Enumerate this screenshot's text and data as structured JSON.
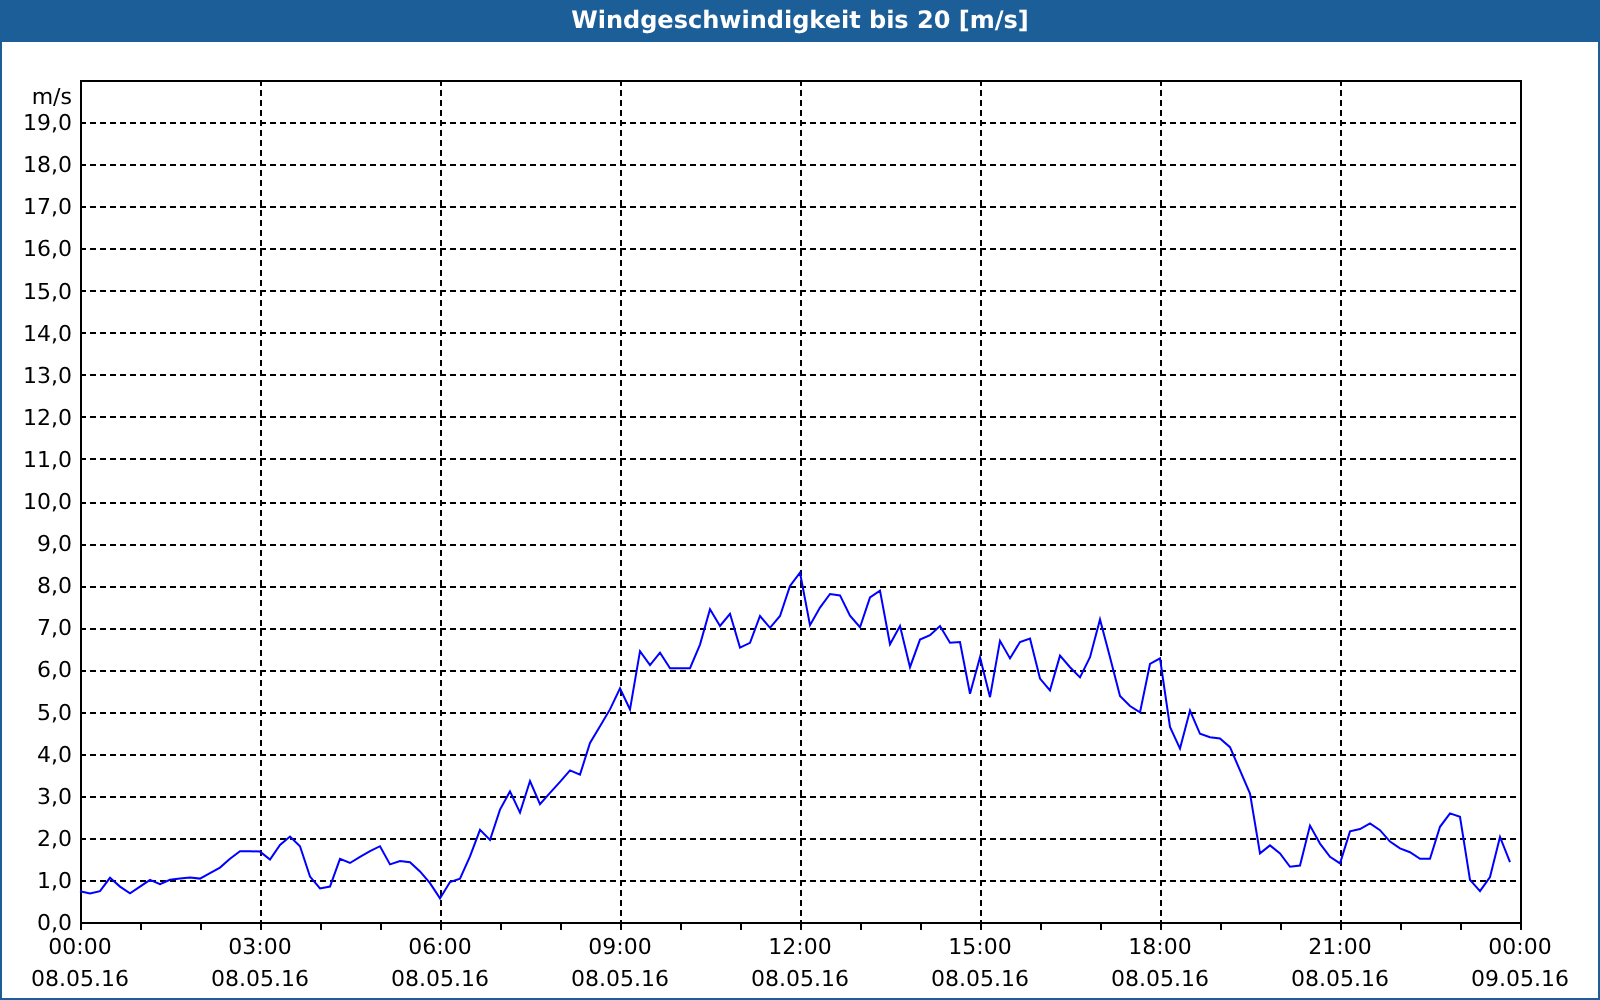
{
  "window": {
    "title": "Windgeschwindigkeit bis 20 [m/s]"
  },
  "chart": {
    "chart_data": {
      "type": "line",
      "ylabel": "m/s",
      "grid": true,
      "ylim": [
        0,
        20
      ],
      "yticks": [
        {
          "value": 0,
          "label": "0,0"
        },
        {
          "value": 1,
          "label": "1,0"
        },
        {
          "value": 2,
          "label": "2,0"
        },
        {
          "value": 3,
          "label": "3,0"
        },
        {
          "value": 4,
          "label": "4,0"
        },
        {
          "value": 5,
          "label": "5,0"
        },
        {
          "value": 6,
          "label": "6,0"
        },
        {
          "value": 7,
          "label": "7,0"
        },
        {
          "value": 8,
          "label": "8,0"
        },
        {
          "value": 9,
          "label": "9,0"
        },
        {
          "value": 10,
          "label": "10,0"
        },
        {
          "value": 11,
          "label": "11,0"
        },
        {
          "value": 12,
          "label": "12,0"
        },
        {
          "value": 13,
          "label": "13,0"
        },
        {
          "value": 14,
          "label": "14,0"
        },
        {
          "value": 15,
          "label": "15,0"
        },
        {
          "value": 16,
          "label": "16,0"
        },
        {
          "value": 17,
          "label": "17,0"
        },
        {
          "value": 18,
          "label": "18,0"
        },
        {
          "value": 19,
          "label": "19,0"
        }
      ],
      "categories": [
        "00:00\n08.05.16",
        null,
        null,
        null,
        null,
        null,
        null,
        null,
        null,
        null,
        null,
        null,
        null,
        null,
        null,
        null,
        null,
        null,
        "03:00\n08.05.16",
        null,
        null,
        null,
        null,
        null,
        null,
        null,
        null,
        null,
        null,
        null,
        null,
        null,
        null,
        null,
        null,
        null,
        "06:00\n08.05.16",
        null,
        null,
        null,
        null,
        null,
        null,
        null,
        null,
        null,
        null,
        null,
        null,
        null,
        null,
        null,
        null,
        null,
        "09:00\n08.05.16",
        null,
        null,
        null,
        null,
        null,
        null,
        null,
        null,
        null,
        null,
        null,
        null,
        null,
        null,
        null,
        null,
        null,
        "12:00\n08.05.16",
        null,
        null,
        null,
        null,
        null,
        null,
        null,
        null,
        null,
        null,
        null,
        null,
        null,
        null,
        null,
        null,
        null,
        "15:00\n08.05.16",
        null,
        null,
        null,
        null,
        null,
        null,
        null,
        null,
        null,
        null,
        null,
        null,
        null,
        null,
        null,
        null,
        null,
        "18:00\n08.05.16",
        null,
        null,
        null,
        null,
        null,
        null,
        null,
        null,
        null,
        null,
        null,
        null,
        null,
        null,
        null,
        null,
        null,
        "21:00\n08.05.16",
        null,
        null,
        null,
        null,
        null,
        null,
        null,
        null,
        null,
        null,
        null,
        null,
        null,
        null,
        null,
        null,
        null,
        "00:00\n09.05.16"
      ],
      "series": [
        {
          "color": "#0000ff",
          "values": [
            0.73,
            0.68,
            0.73,
            1.05,
            0.84,
            0.68,
            0.84,
            1.0,
            0.9,
            1.0,
            1.03,
            1.06,
            1.03,
            1.16,
            1.29,
            1.5,
            1.68,
            1.68,
            1.67,
            1.48,
            1.83,
            2.03,
            1.8,
            1.08,
            0.8,
            0.84,
            1.5,
            1.4,
            1.55,
            1.68,
            1.8,
            1.37,
            1.45,
            1.42,
            1.2,
            0.92,
            0.56,
            0.95,
            1.03,
            1.56,
            2.19,
            1.95,
            2.67,
            3.1,
            2.6,
            3.35,
            2.8,
            3.07,
            3.33,
            3.6,
            3.5,
            4.25,
            4.65,
            5.05,
            5.55,
            5.05,
            6.43,
            6.1,
            6.4,
            6.03,
            6.03,
            6.03,
            6.59,
            7.43,
            7.03,
            7.32,
            6.52,
            6.63,
            7.27,
            6.99,
            7.27,
            7.98,
            8.3,
            7.05,
            7.47,
            7.79,
            7.76,
            7.28,
            7.0,
            7.71,
            7.87,
            6.6,
            7.03,
            6.05,
            6.71,
            6.81,
            7.03,
            6.63,
            6.65,
            5.42,
            6.29,
            5.34,
            6.68,
            6.26,
            6.65,
            6.73,
            5.78,
            5.5,
            6.33,
            6.05,
            5.81,
            6.29,
            7.19,
            6.29,
            5.37,
            5.13,
            4.98,
            6.13,
            6.26,
            4.63,
            4.12,
            5.02,
            4.47,
            4.39,
            4.36,
            4.15,
            3.6,
            3.05,
            1.63,
            1.82,
            1.63,
            1.31,
            1.34,
            2.29,
            1.86,
            1.55,
            1.39,
            2.15,
            2.21,
            2.34,
            2.18,
            1.91,
            1.75,
            1.66,
            1.5,
            1.5,
            2.26,
            2.58,
            2.5,
            1.0,
            0.73,
            1.07,
            2.02,
            1.42,
            null
          ]
        }
      ]
    }
  }
}
